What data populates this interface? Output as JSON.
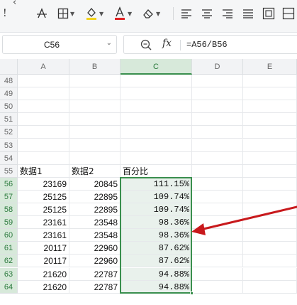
{
  "toolbar": {
    "back_icon": "chevron-left-icon",
    "items": [
      {
        "name": "italic-icon",
        "glyph": "!"
      },
      {
        "name": "strikethrough-icon",
        "glyph": "A"
      },
      {
        "name": "borders-icon",
        "glyph": "⊞"
      },
      {
        "name": "fill-color-icon",
        "glyph": "◇"
      },
      {
        "name": "font-color-icon",
        "glyph": "A"
      },
      {
        "name": "clear-format-icon",
        "glyph": "⌫"
      },
      {
        "name": "align-left-icon",
        "glyph": "≡"
      },
      {
        "name": "align-center-icon",
        "glyph": "≡"
      },
      {
        "name": "align-right-icon",
        "glyph": "≡"
      },
      {
        "name": "justify-icon",
        "glyph": "≣"
      },
      {
        "name": "wrap-text-icon",
        "glyph": "⊡"
      },
      {
        "name": "merge-cells-icon",
        "glyph": "⊟"
      }
    ],
    "fill_color": "#f2d21b",
    "font_color": "#e02424"
  },
  "formula_bar": {
    "cell_ref": "C56",
    "fx_label": "fx",
    "formula": "=A56/B56"
  },
  "columns": [
    "A",
    "B",
    "C",
    "D",
    "E"
  ],
  "selected_column": "C",
  "rows": [
    {
      "n": "48",
      "a": "",
      "b": "",
      "c": ""
    },
    {
      "n": "49",
      "a": "",
      "b": "",
      "c": ""
    },
    {
      "n": "50",
      "a": "",
      "b": "",
      "c": ""
    },
    {
      "n": "51",
      "a": "",
      "b": "",
      "c": ""
    },
    {
      "n": "52",
      "a": "",
      "b": "",
      "c": ""
    },
    {
      "n": "53",
      "a": "",
      "b": "",
      "c": ""
    },
    {
      "n": "54",
      "a": "",
      "b": "",
      "c": ""
    },
    {
      "n": "55",
      "a": "数据1",
      "b": "数据2",
      "c": "百分比"
    },
    {
      "n": "56",
      "a": "23169",
      "b": "20845",
      "c": "111.15%"
    },
    {
      "n": "57",
      "a": "25125",
      "b": "22895",
      "c": "109.74%"
    },
    {
      "n": "58",
      "a": "25125",
      "b": "22895",
      "c": "109.74%"
    },
    {
      "n": "59",
      "a": "23161",
      "b": "23548",
      "c": "98.36%"
    },
    {
      "n": "60",
      "a": "23161",
      "b": "23548",
      "c": "98.36%"
    },
    {
      "n": "61",
      "a": "20117",
      "b": "22960",
      "c": "87.62%"
    },
    {
      "n": "62",
      "a": "20117",
      "b": "22960",
      "c": "87.62%"
    },
    {
      "n": "63",
      "a": "21620",
      "b": "22787",
      "c": "94.88%"
    },
    {
      "n": "64",
      "a": "21620",
      "b": "22787",
      "c": "94.88%"
    }
  ],
  "selection": {
    "from_row": "56",
    "to_row": "64",
    "color": "#3a8f4e"
  },
  "annotation_arrow_color": "#c8191c"
}
